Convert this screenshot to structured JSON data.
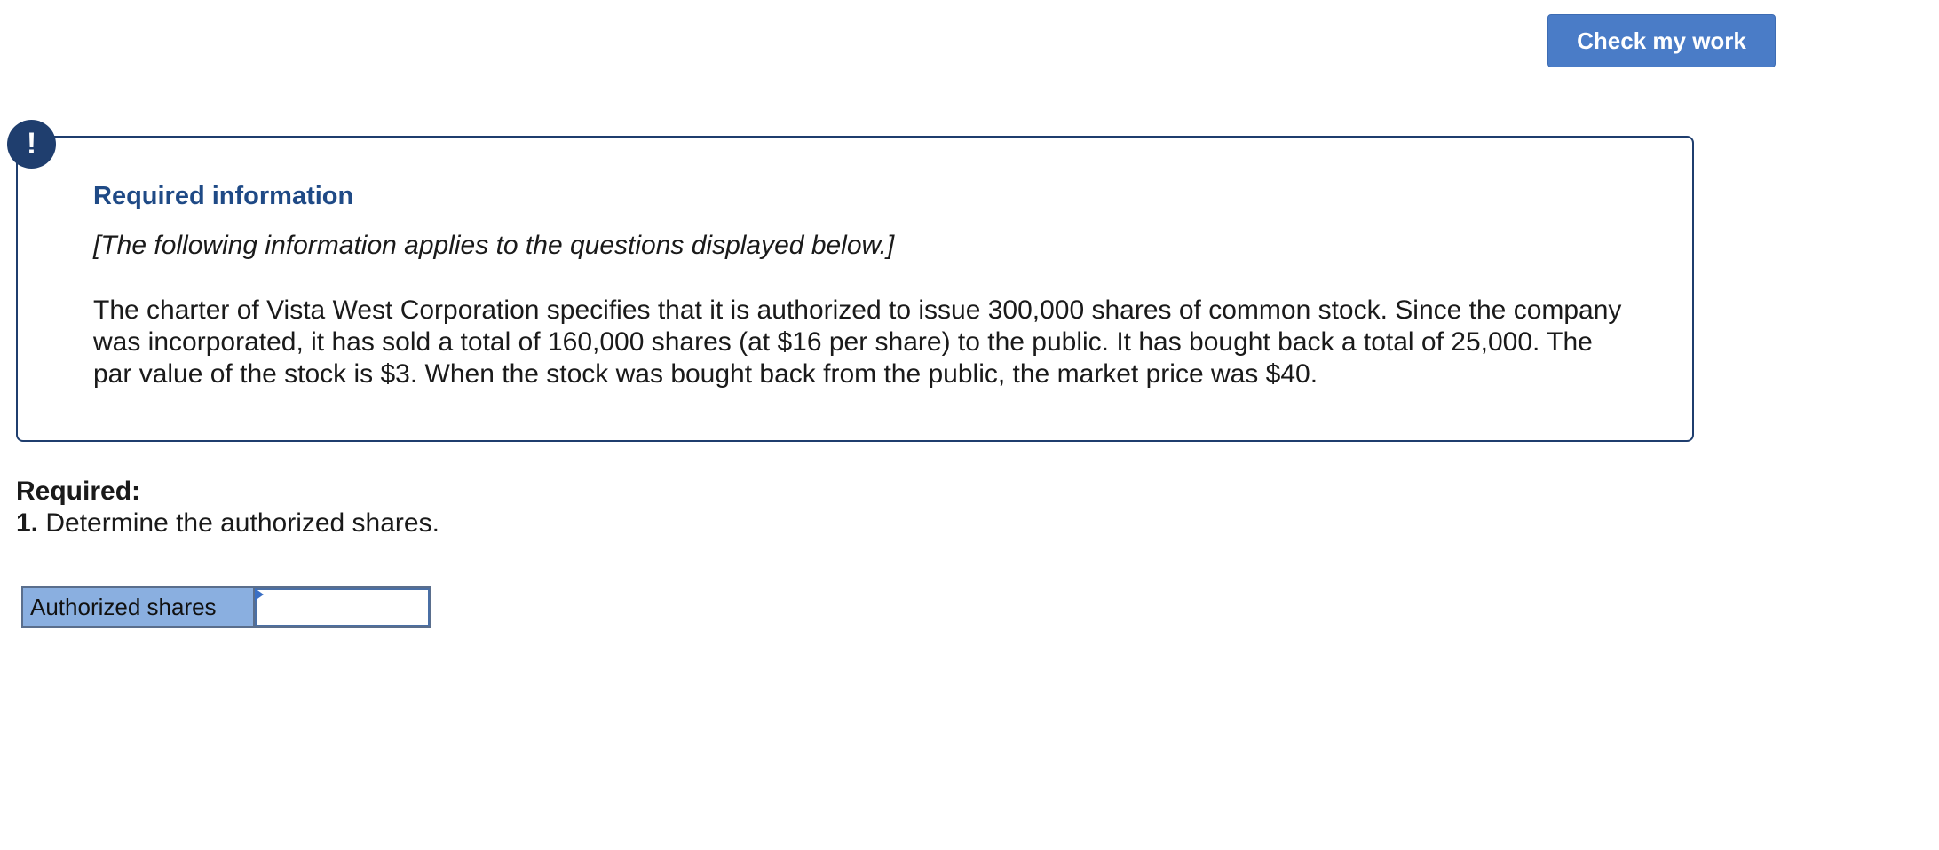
{
  "toolbar": {
    "check_label": "Check my work"
  },
  "info": {
    "alert_glyph": "!",
    "title": "Required information",
    "applies_note": "[The following information applies to the questions displayed below.]",
    "problem_text": "The charter of Vista West Corporation specifies that it is authorized to issue 300,000 shares of common stock. Since the company was incorporated, it has sold a total of 160,000 shares (at $16 per share) to the public. It has bought back a total of 25,000. The par value of the stock is $3. When the stock was bought back from the public, the market price was $40."
  },
  "question": {
    "required_label": "Required:",
    "number": "1.",
    "text": " Determine the authorized shares."
  },
  "answer": {
    "label": "Authorized shares",
    "value": ""
  },
  "colors": {
    "button_bg": "#4a7cc7",
    "box_border": "#1f3e6e",
    "title_color": "#1f4a86",
    "label_cell_bg": "#8aafe0"
  },
  "icons": {
    "alert": "exclamation-circle-icon",
    "cell_marker": "triangle-marker-icon"
  }
}
